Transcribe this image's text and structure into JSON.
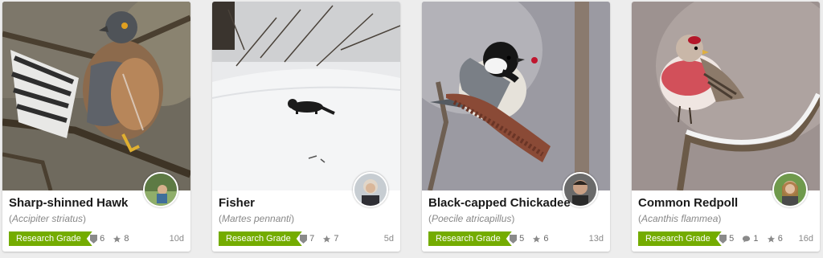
{
  "cards": [
    {
      "common_name": "Sharp-shinned Hawk",
      "scientific_name": "Accipiter striatus",
      "quality_grade": "Research Grade",
      "ids_count": "6",
      "faves_count": "8",
      "age": "10d"
    },
    {
      "common_name": "Fisher",
      "scientific_name": "Martes pennanti",
      "quality_grade": "Research Grade",
      "ids_count": "7",
      "faves_count": "7",
      "age": "5d"
    },
    {
      "common_name": "Black-capped Chickadee",
      "scientific_name": "Poecile atricapillus",
      "quality_grade": "Research Grade",
      "ids_count": "5",
      "faves_count": "6",
      "age": "13d"
    },
    {
      "common_name": "Common Redpoll",
      "scientific_name": "Acanthis flammea",
      "quality_grade": "Research Grade",
      "ids_count": "5",
      "comments_count": "1",
      "faves_count": "6",
      "age": "16d"
    }
  ],
  "colors": {
    "research_grade": "#74ac00",
    "background": "#ededed"
  }
}
